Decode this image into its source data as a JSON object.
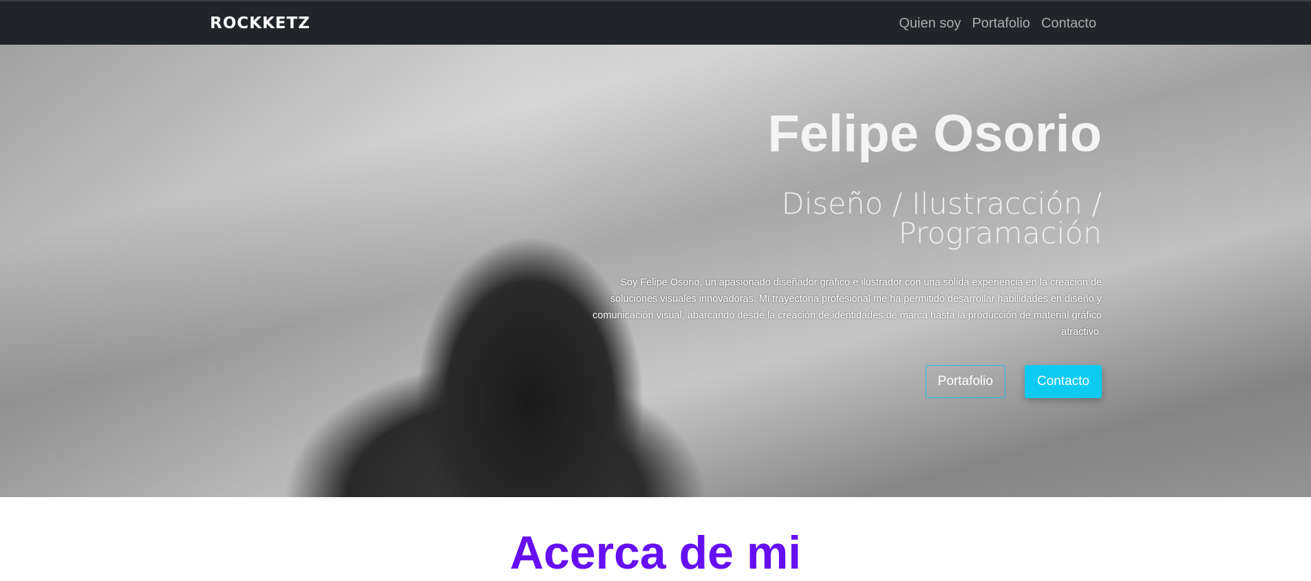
{
  "navbar": {
    "brand": "ROCKKETZ",
    "links": [
      "Quien soy",
      "Portafolio",
      "Contacto"
    ]
  },
  "hero": {
    "title": "Felipe Osorio",
    "subtitle": "Diseño / Ilustracción / Programación",
    "description": "Soy Felipe Osorio, un apasionado diseñador gráfico e ilustrador con una sólida experiencia en la creación de soluciones visuales innovadoras. Mi trayectoria profesional me ha permitido desarrollar habilidades en diseño y comunicación visual, abarcando desde la creación de identidades de marca hasta la producción de material gráfico atractivo.",
    "buttons": {
      "portfolio": "Portafolio",
      "contact": "Contacto"
    }
  },
  "about": {
    "title": "Acerca de mi"
  },
  "colors": {
    "navbar_bg": "#212529",
    "accent_cyan": "#0dcaf0",
    "heading_purple": "#6610f2"
  }
}
